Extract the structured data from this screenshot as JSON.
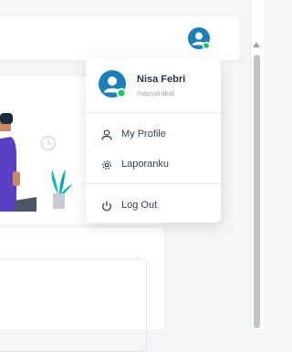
{
  "user": {
    "name": "Nisa Febri",
    "role": "masyarakat",
    "status_color": "#22c55e",
    "avatar_color": "#1e7fb8"
  },
  "menu": {
    "items": [
      {
        "label": "My Profile",
        "icon": "user-icon"
      },
      {
        "label": "Laporanku",
        "icon": "gear-icon"
      },
      {
        "label": "Log Out",
        "icon": "power-icon"
      }
    ]
  }
}
